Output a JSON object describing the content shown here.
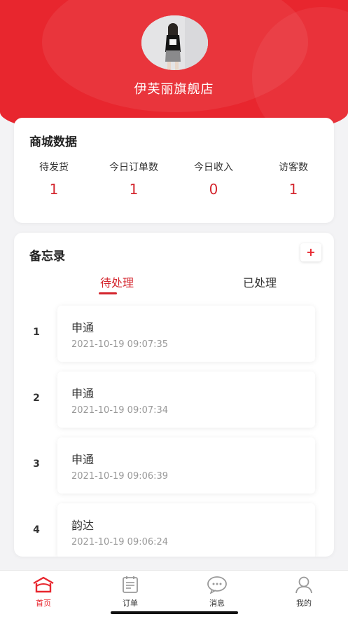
{
  "header": {
    "shop_name": "伊芙丽旗舰店"
  },
  "stats": {
    "title": "商城数据",
    "items": [
      {
        "label": "待发货",
        "value": "1"
      },
      {
        "label": "今日订单数",
        "value": "1"
      },
      {
        "label": "今日收入",
        "value": "0"
      },
      {
        "label": "访客数",
        "value": "1"
      }
    ]
  },
  "memo": {
    "title": "备忘录",
    "add_label": "+",
    "tabs": [
      {
        "label": "待处理",
        "active": true
      },
      {
        "label": "已处理",
        "active": false
      }
    ],
    "items": [
      {
        "index": "1",
        "name": "申通",
        "time": "2021-10-19 09:07:35"
      },
      {
        "index": "2",
        "name": "申通",
        "time": "2021-10-19 09:07:34"
      },
      {
        "index": "3",
        "name": "申通",
        "time": "2021-10-19 09:06:39"
      },
      {
        "index": "4",
        "name": "韵达",
        "time": "2021-10-19 09:06:24"
      }
    ]
  },
  "tabbar": {
    "items": [
      {
        "label": "首页",
        "icon": "home-icon",
        "active": true
      },
      {
        "label": "订单",
        "icon": "order-icon",
        "active": false
      },
      {
        "label": "消息",
        "icon": "message-icon",
        "active": false
      },
      {
        "label": "我的",
        "icon": "profile-icon",
        "active": false
      }
    ]
  },
  "colors": {
    "brand": "#e8262e",
    "value": "#d4262e",
    "background": "#f3f3f5"
  }
}
